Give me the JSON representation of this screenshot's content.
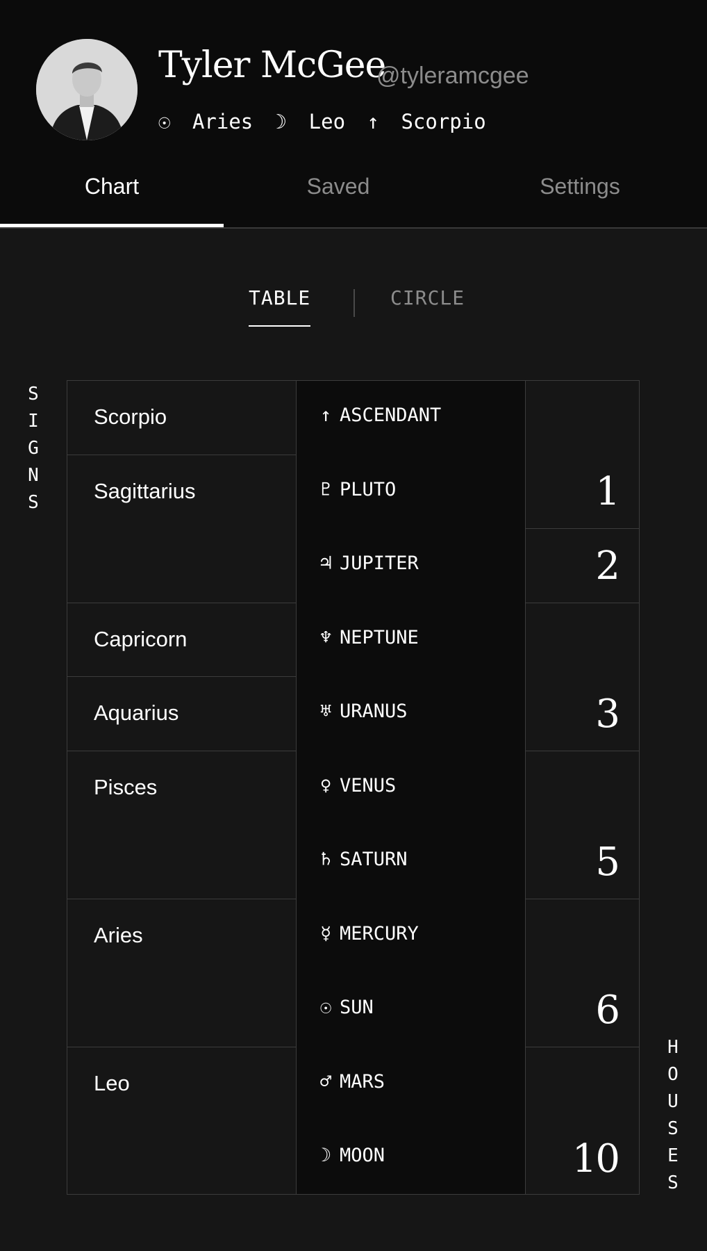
{
  "profile": {
    "name": "Tyler McGee",
    "handle": "@tyleramcgee",
    "sun_glyph": "☉",
    "sun_sign": "Aries",
    "moon_glyph": "☽",
    "moon_sign": "Leo",
    "rising_glyph": "↑",
    "rising_sign": "Scorpio"
  },
  "tabs": [
    {
      "label": "Chart",
      "active": true
    },
    {
      "label": "Saved",
      "active": false
    },
    {
      "label": "Settings",
      "active": false
    }
  ],
  "view_toggle": {
    "table_label": "TABLE",
    "circle_label": "CIRCLE",
    "selected": "TABLE"
  },
  "side_labels": {
    "signs": [
      "S",
      "I",
      "G",
      "N",
      "S"
    ],
    "houses": [
      "H",
      "O",
      "U",
      "S",
      "E",
      "S"
    ]
  },
  "signs": [
    {
      "name": "Scorpio"
    },
    {
      "name": "Sagittarius"
    },
    {
      "name": "Capricorn"
    },
    {
      "name": "Aquarius"
    },
    {
      "name": "Pisces"
    },
    {
      "name": "Aries"
    },
    {
      "name": "Leo"
    }
  ],
  "planets": [
    {
      "glyph": "↑",
      "name": "ASCENDANT"
    },
    {
      "glyph": "♇",
      "name": "PLUTO"
    },
    {
      "glyph": "♃",
      "name": "JUPITER"
    },
    {
      "glyph": "♆",
      "name": "NEPTUNE"
    },
    {
      "glyph": "♅",
      "name": "URANUS"
    },
    {
      "glyph": "♀",
      "name": "VENUS"
    },
    {
      "glyph": "♄",
      "name": "SATURN"
    },
    {
      "glyph": "☿",
      "name": "MERCURY"
    },
    {
      "glyph": "☉",
      "name": "SUN"
    },
    {
      "glyph": "♂",
      "name": "MARS"
    },
    {
      "glyph": "☽",
      "name": "MOON"
    }
  ],
  "houses": [
    {
      "number": "1"
    },
    {
      "number": "2"
    },
    {
      "number": "3"
    },
    {
      "number": "5"
    },
    {
      "number": "6"
    },
    {
      "number": "10"
    }
  ]
}
